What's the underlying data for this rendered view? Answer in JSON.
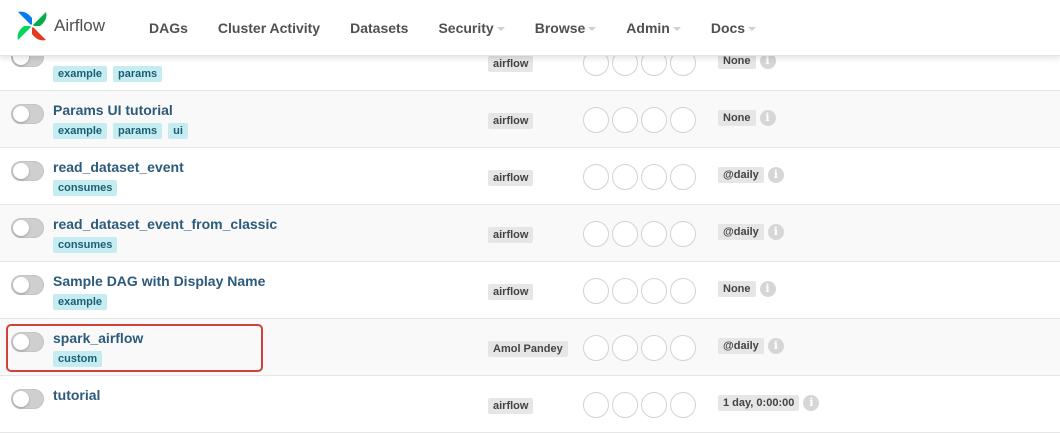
{
  "brand": {
    "name": "Airflow",
    "icon": "airflow-pinwheel-icon"
  },
  "nav": {
    "items": [
      {
        "label": "DAGs",
        "dropdown": false
      },
      {
        "label": "Cluster Activity",
        "dropdown": false
      },
      {
        "label": "Datasets",
        "dropdown": false
      },
      {
        "label": "Security",
        "dropdown": true
      },
      {
        "label": "Browse",
        "dropdown": true
      },
      {
        "label": "Admin",
        "dropdown": true
      },
      {
        "label": "Docs",
        "dropdown": true
      }
    ]
  },
  "rows": [
    {
      "name": "",
      "tags": [
        "example",
        "params"
      ],
      "owner": "airflow",
      "schedule": "None"
    },
    {
      "name": "Params UI tutorial",
      "tags": [
        "example",
        "params",
        "ui"
      ],
      "owner": "airflow",
      "schedule": "None"
    },
    {
      "name": "read_dataset_event",
      "tags": [
        "consumes"
      ],
      "owner": "airflow",
      "schedule": "@daily"
    },
    {
      "name": "read_dataset_event_from_classic",
      "tags": [
        "consumes"
      ],
      "owner": "airflow",
      "schedule": "@daily"
    },
    {
      "name": "Sample DAG with Display Name",
      "tags": [
        "example"
      ],
      "owner": "airflow",
      "schedule": "None"
    },
    {
      "name": "spark_airflow",
      "tags": [
        "custom"
      ],
      "owner": "Amol Pandey",
      "schedule": "@daily"
    },
    {
      "name": "tutorial",
      "tags": [],
      "owner": "airflow",
      "schedule": "1 day, 0:00:00"
    }
  ],
  "info_symbol": "i",
  "colors": {
    "highlight": "#d0413b",
    "tag_bg": "#c5ecf0",
    "link": "#2c5a7a"
  }
}
